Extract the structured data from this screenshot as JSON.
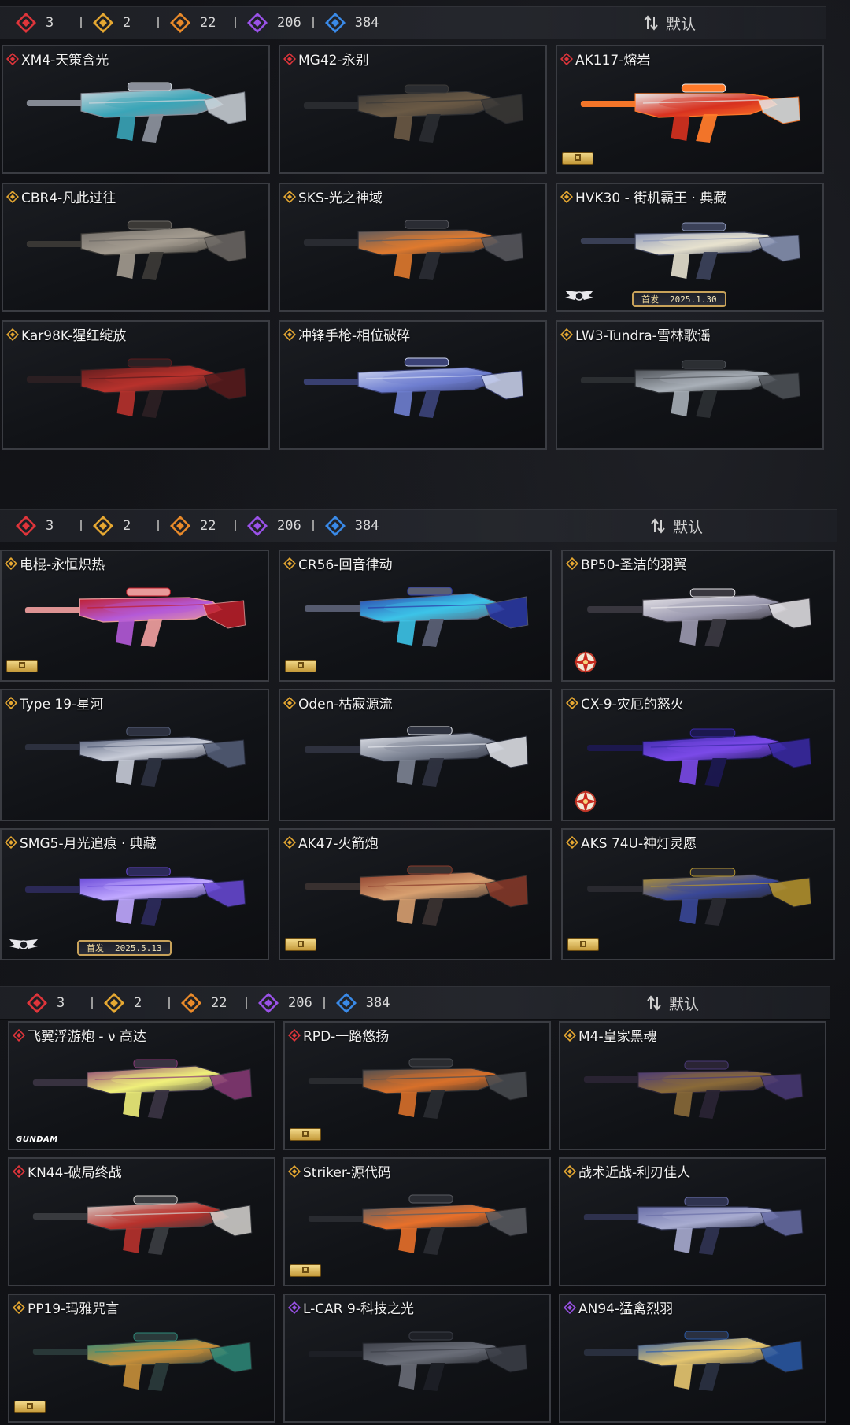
{
  "sections": [
    {
      "rarity_counts": [
        "3",
        "2",
        "22",
        "206",
        "384"
      ],
      "sort_label": "默认",
      "cards": [
        {
          "name": "XM4-天策含光",
          "tier": "red",
          "palette": [
            "#cfd6dc",
            "#3aa5b8",
            "#8a8f9a"
          ]
        },
        {
          "name": "MG42-永别",
          "tier": "red",
          "palette": [
            "#3c3a38",
            "#6b5a45",
            "#2a2c30"
          ]
        },
        {
          "name": "AK117-熔岩",
          "tier": "red",
          "palette": [
            "#e8e8e8",
            "#d8321f",
            "#ff7a2a"
          ],
          "badge": "gold"
        },
        {
          "name": "CBR4-凡此过往",
          "tier": "gold",
          "palette": [
            "#6e6a66",
            "#a49c90",
            "#3b3936"
          ]
        },
        {
          "name": "SKS-光之神域",
          "tier": "gold",
          "palette": [
            "#5a5a60",
            "#e07a2e",
            "#2a2c33"
          ]
        },
        {
          "name": "HVK30 - 街机霸王 · 典藏",
          "tier": "gold",
          "palette": [
            "#8c97b8",
            "#e7e2cf",
            "#3b4158"
          ],
          "badge": "wings",
          "release": {
            "first": "首发",
            "date": "2025.1.30"
          }
        },
        {
          "name": "Kar98K-猩红绽放",
          "tier": "gold",
          "palette": [
            "#5a1b1d",
            "#b8322c",
            "#2c2023"
          ]
        },
        {
          "name": "冲锋手枪-相位破碎",
          "tier": "gold",
          "palette": [
            "#cfd7f2",
            "#6f7fd0",
            "#3b4276"
          ]
        },
        {
          "name": "LW3-Tundra-雪林歌谣",
          "tier": "gold",
          "palette": [
            "#50545a",
            "#a9b0b8",
            "#2c2f33"
          ]
        }
      ]
    },
    {
      "rarity_counts": [
        "3",
        "2",
        "22",
        "206",
        "384"
      ],
      "sort_label": "默认",
      "cards": [
        {
          "name": "电棍-永恒炽热",
          "tier": "gold",
          "palette": [
            "#c01e2a",
            "#b45ad8",
            "#e89a9a"
          ],
          "badge": "gold"
        },
        {
          "name": "CR56-回音律动",
          "tier": "gold",
          "palette": [
            "#2c3aa8",
            "#3cc4e8",
            "#5a5f74"
          ],
          "badge": "gold"
        },
        {
          "name": "BP50-圣洁的羽翼",
          "tier": "gold",
          "palette": [
            "#e8e6ea",
            "#9c9ab0",
            "#3a3840"
          ],
          "badge": "star"
        },
        {
          "name": "Type 19-星河",
          "tier": "gold",
          "palette": [
            "#56607a",
            "#c8ccd8",
            "#2d3140"
          ]
        },
        {
          "name": "Oden-枯寂源流",
          "tier": "gold",
          "palette": [
            "#e6e8ee",
            "#7d8494",
            "#2f3340"
          ]
        },
        {
          "name": "CX-9-灾厄的怒火",
          "tier": "gold",
          "palette": [
            "#3b2aa8",
            "#7b4ae8",
            "#1c1850"
          ],
          "badge": "star"
        },
        {
          "name": "SMG5-月光追痕 · 典藏",
          "tier": "gold",
          "palette": [
            "#6a4ad8",
            "#c0a8ff",
            "#2c2a5a"
          ],
          "badge": "wings",
          "release": {
            "first": "首发",
            "date": "2025.5.13"
          }
        },
        {
          "name": "AK47-火箭炮",
          "tier": "gold",
          "palette": [
            "#8a3a2a",
            "#d8a070",
            "#3a3230"
          ],
          "badge": "gold"
        },
        {
          "name": "AKS 74U-神灯灵愿",
          "tier": "gold",
          "palette": [
            "#b8962e",
            "#3a4898",
            "#2a2a30"
          ],
          "badge": "gold"
        }
      ]
    },
    {
      "rarity_counts": [
        "3",
        "2",
        "22",
        "206",
        "384"
      ],
      "sort_label": "默认",
      "cards": [
        {
          "name": "飞翼浮游炮 - ν 高达",
          "tier": "red",
          "palette": [
            "#8a3a78",
            "#f0f07a",
            "#3a3442"
          ],
          "badge": "gundam",
          "gundam_text": "GUNDAM"
        },
        {
          "name": "RPD-一路悠扬",
          "tier": "red",
          "palette": [
            "#4a4d52",
            "#d8702a",
            "#2a2c30"
          ],
          "badge": "gold"
        },
        {
          "name": "M4-皇家黑魂",
          "tier": "gold",
          "palette": [
            "#4a3a78",
            "#8a6a38",
            "#2a2434"
          ]
        },
        {
          "name": "KN44-破局终战",
          "tier": "red",
          "palette": [
            "#d8d6d2",
            "#b8322c",
            "#3a3c40"
          ]
        },
        {
          "name": "Striker-源代码",
          "tier": "gold",
          "palette": [
            "#5a5c62",
            "#e8702a",
            "#2a2c32"
          ],
          "badge": "gold"
        },
        {
          "name": "战术近战-利刃佳人",
          "tier": "gold",
          "palette": [
            "#6a6fa8",
            "#a8acd0",
            "#2f3350"
          ]
        },
        {
          "name": "PP19-玛雅咒言",
          "tier": "gold",
          "palette": [
            "#2e8a7a",
            "#c8903a",
            "#2a3a3a"
          ],
          "badge": "gold"
        },
        {
          "name": "L-CAR 9-科技之光",
          "tier": "purple",
          "palette": [
            "#3c3f48",
            "#6a6e78",
            "#1e2026"
          ]
        },
        {
          "name": "AN94-猛禽烈羽",
          "tier": "purple",
          "palette": [
            "#2a5aa8",
            "#e8c870",
            "#2a3040"
          ]
        }
      ]
    }
  ],
  "icons": {
    "rarity": [
      "red-diamond-icon",
      "gold-diamond-icon",
      "orange-diamond-icon",
      "purple-diamond-icon",
      "blue-diamond-icon"
    ],
    "sort": "sort-arrows-icon"
  },
  "colors": {
    "red": "#e0353b",
    "gold": "#e6a832",
    "orange": "#e98a2a",
    "purple": "#9a52e8",
    "blue": "#3a8ae8"
  }
}
